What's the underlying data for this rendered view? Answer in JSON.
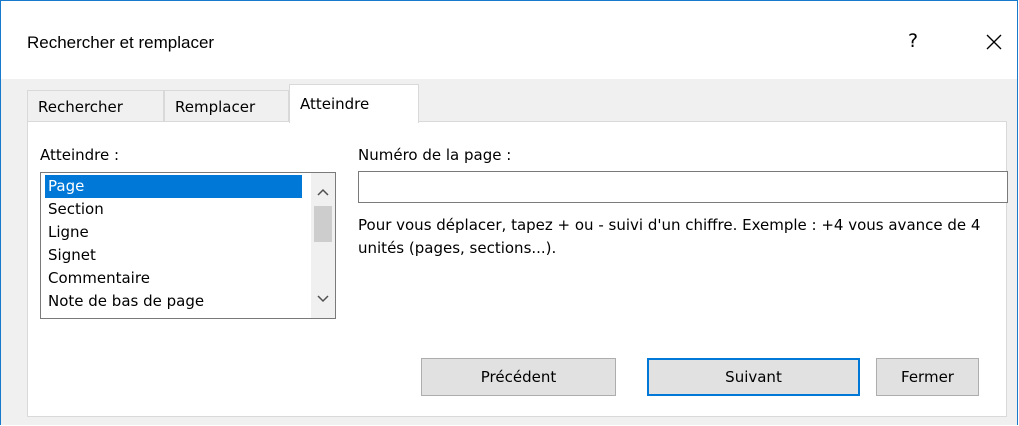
{
  "window": {
    "title": "Rechercher et remplacer",
    "help_label": "?"
  },
  "tabs": [
    {
      "label": "Rechercher",
      "active": false
    },
    {
      "label": "Remplacer",
      "active": false
    },
    {
      "label": "Atteindre",
      "active": true
    }
  ],
  "goto": {
    "list_label": "Atteindre :",
    "items": [
      "Page",
      "Section",
      "Ligne",
      "Signet",
      "Commentaire",
      "Note de bas de page"
    ],
    "selected_item": "Page",
    "input_label": "Numéro de la page :",
    "input_value": "",
    "help_text": "Pour vous déplacer, tapez + ou - suivi d'un chiffre. Exemple : +4 vous avance de 4 unités (pages, sections...)."
  },
  "buttons": {
    "previous": "Précédent",
    "next": "Suivant",
    "close": "Fermer"
  },
  "colors": {
    "accent": "#0078d7",
    "window_border": "#1979ca",
    "button_face": "#e1e1e1",
    "dialog_bg": "#f0f0f0"
  }
}
